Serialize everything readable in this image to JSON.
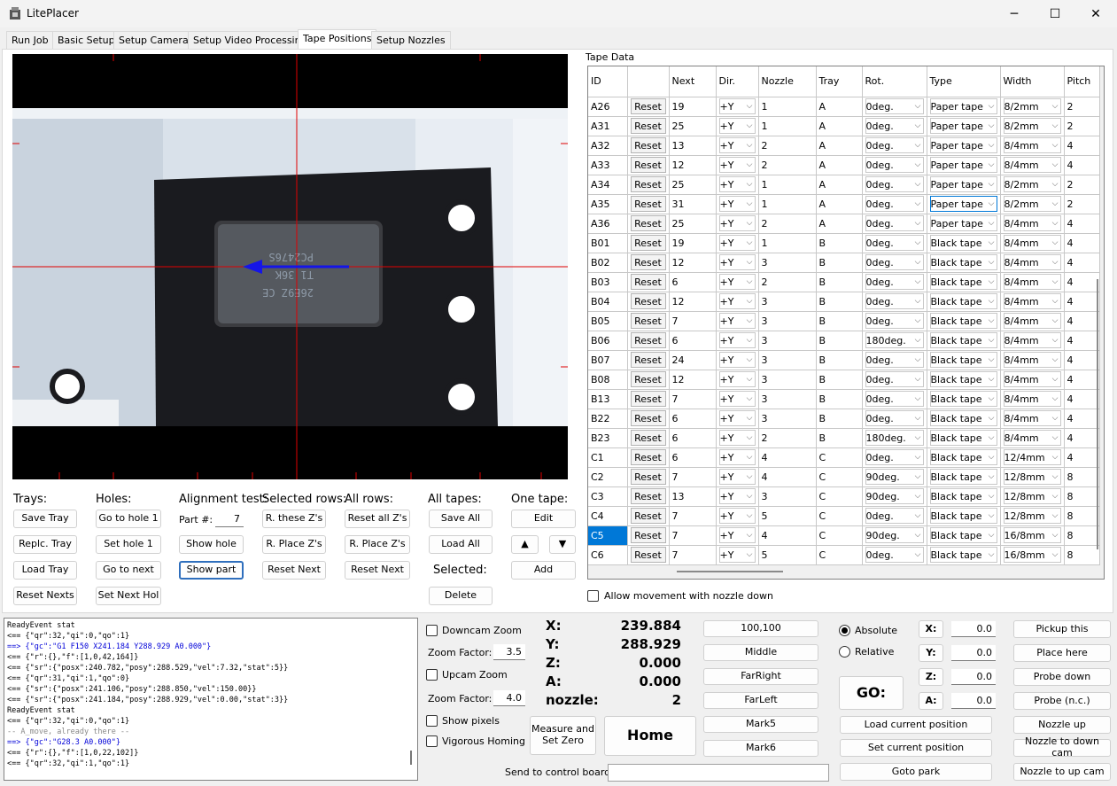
{
  "window": {
    "title": "LitePlacer",
    "minimize": "─",
    "maximize": "☐",
    "close": "✕"
  },
  "tabs": [
    "Run Job",
    "Basic Setup",
    "Setup Cameras",
    "Setup Video Processing",
    "Tape Positions",
    "Setup Nozzles"
  ],
  "tape_data_label": "Tape Data",
  "columns": [
    "ID",
    "",
    "Next",
    "Dir.",
    "Nozzle",
    "Tray",
    "Rot.",
    "Type",
    "Width",
    "Pitch"
  ],
  "reset_label": "Reset",
  "rows": [
    [
      "A26",
      "19",
      "+Y",
      "1",
      "A",
      "0deg.",
      "Paper tape",
      "8/2mm",
      "2"
    ],
    [
      "A31",
      "25",
      "+Y",
      "1",
      "A",
      "0deg.",
      "Paper tape",
      "8/2mm",
      "2"
    ],
    [
      "A32",
      "13",
      "+Y",
      "2",
      "A",
      "0deg.",
      "Paper tape",
      "8/4mm",
      "4"
    ],
    [
      "A33",
      "12",
      "+Y",
      "2",
      "A",
      "0deg.",
      "Paper tape",
      "8/4mm",
      "4"
    ],
    [
      "A34",
      "25",
      "+Y",
      "1",
      "A",
      "0deg.",
      "Paper tape",
      "8/2mm",
      "2"
    ],
    [
      "A35",
      "31",
      "+Y",
      "1",
      "A",
      "0deg.",
      "Paper tape",
      "8/2mm",
      "2"
    ],
    [
      "A36",
      "25",
      "+Y",
      "2",
      "A",
      "0deg.",
      "Paper tape",
      "8/4mm",
      "4"
    ],
    [
      "B01",
      "19",
      "+Y",
      "1",
      "B",
      "0deg.",
      "Black tape",
      "8/4mm",
      "4"
    ],
    [
      "B02",
      "12",
      "+Y",
      "3",
      "B",
      "0deg.",
      "Black tape",
      "8/4mm",
      "4"
    ],
    [
      "B03",
      "6",
      "+Y",
      "2",
      "B",
      "0deg.",
      "Black tape",
      "8/4mm",
      "4"
    ],
    [
      "B04",
      "12",
      "+Y",
      "3",
      "B",
      "0deg.",
      "Black tape",
      "8/4mm",
      "4"
    ],
    [
      "B05",
      "7",
      "+Y",
      "3",
      "B",
      "0deg.",
      "Black tape",
      "8/4mm",
      "4"
    ],
    [
      "B06",
      "6",
      "+Y",
      "3",
      "B",
      "180deg.",
      "Black tape",
      "8/4mm",
      "4"
    ],
    [
      "B07",
      "24",
      "+Y",
      "3",
      "B",
      "0deg.",
      "Black tape",
      "8/4mm",
      "4"
    ],
    [
      "B08",
      "12",
      "+Y",
      "3",
      "B",
      "0deg.",
      "Black tape",
      "8/4mm",
      "4"
    ],
    [
      "B13",
      "7",
      "+Y",
      "3",
      "B",
      "0deg.",
      "Black tape",
      "8/4mm",
      "4"
    ],
    [
      "B22",
      "6",
      "+Y",
      "3",
      "B",
      "0deg.",
      "Black tape",
      "8/4mm",
      "4"
    ],
    [
      "B23",
      "6",
      "+Y",
      "2",
      "B",
      "180deg.",
      "Black tape",
      "8/4mm",
      "4"
    ],
    [
      "C1",
      "6",
      "+Y",
      "4",
      "C",
      "0deg.",
      "Black tape",
      "12/4mm",
      "4"
    ],
    [
      "C2",
      "7",
      "+Y",
      "4",
      "C",
      "90deg.",
      "Black tape",
      "12/8mm",
      "8"
    ],
    [
      "C3",
      "13",
      "+Y",
      "3",
      "C",
      "90deg.",
      "Black tape",
      "12/8mm",
      "8"
    ],
    [
      "C4",
      "7",
      "+Y",
      "5",
      "C",
      "0deg.",
      "Black tape",
      "12/8mm",
      "8"
    ],
    [
      "C5",
      "7",
      "+Y",
      "4",
      "C",
      "90deg.",
      "Black tape",
      "16/8mm",
      "8"
    ],
    [
      "C6",
      "7",
      "+Y",
      "5",
      "C",
      "0deg.",
      "Black tape",
      "16/8mm",
      "8"
    ]
  ],
  "selected_id": "C5",
  "camera": {
    "chip_text": [
      "26E9Z CE",
      "T1 36K",
      "PC2476S"
    ]
  },
  "groups": {
    "trays": {
      "title": "Trays:",
      "buttons": [
        "Save Tray",
        "Replc. Tray",
        "Load Tray",
        "Reset Nexts"
      ]
    },
    "holes": {
      "title": "Holes:",
      "buttons": [
        "Go to hole 1",
        "Set hole 1",
        "Go to next",
        "Set Next Hol"
      ]
    },
    "alignment": {
      "title": "Alignment test:",
      "part_label": "Part #:",
      "part_value": "7",
      "buttons": [
        "Show hole",
        "Show part"
      ]
    },
    "selected_rows": {
      "title": "Selected rows:",
      "buttons": [
        "R. these Z's",
        "R. Place Z's",
        "Reset Next"
      ]
    },
    "all_rows": {
      "title": "All rows:",
      "buttons": [
        "Reset all Z's",
        "R. Place Z's",
        "Reset Next"
      ]
    },
    "all_tapes": {
      "title": "All tapes:",
      "buttons": [
        "Save All",
        "Load All"
      ],
      "selected_label": "Selected:",
      "delete": "Delete"
    },
    "one_tape": {
      "title": "One tape:",
      "edit": "Edit",
      "up": "▲",
      "down": "▼",
      "add": "Add"
    }
  },
  "allow_movement": "Allow movement with nozzle down",
  "log": [
    {
      "t": "ReadyEvent stat",
      "c": ""
    },
    {
      "t": "<== {\"qr\":32,\"qi\":0,\"qo\":1}",
      "c": ""
    },
    {
      "t": "==> {\"gc\":\"G1 F150 X241.184 Y288.929 A0.000\"}",
      "c": "blue"
    },
    {
      "t": "<== {\"r\":{},\"f\":[1,0,42,164]}",
      "c": ""
    },
    {
      "t": "<== {\"sr\":{\"posx\":240.782,\"posy\":288.529,\"vel\":7.32,\"stat\":5}}",
      "c": ""
    },
    {
      "t": "<== {\"qr\":31,\"qi\":1,\"qo\":0}",
      "c": ""
    },
    {
      "t": "<== {\"sr\":{\"posx\":241.106,\"posy\":288.850,\"vel\":150.00}}",
      "c": ""
    },
    {
      "t": "<== {\"sr\":{\"posx\":241.184,\"posy\":288.929,\"vel\":0.00,\"stat\":3}}",
      "c": ""
    },
    {
      "t": "ReadyEvent stat",
      "c": ""
    },
    {
      "t": "<== {\"qr\":32,\"qi\":0,\"qo\":1}",
      "c": ""
    },
    {
      "t": " -- A_move, already there --",
      "c": "gray"
    },
    {
      "t": "==> {\"gc\":\"G28.3 A0.000\"}",
      "c": "blue"
    },
    {
      "t": "<== {\"r\":{},\"f\":[1,0,22,102]}",
      "c": ""
    },
    {
      "t": "<== {\"qr\":32,\"qi\":1,\"qo\":1}",
      "c": ""
    }
  ],
  "zoom": {
    "downcam": "Downcam Zoom",
    "upcam": "Upcam Zoom",
    "factor_label": "Zoom Factor:",
    "down_factor": "3.5",
    "up_factor": "4.0",
    "show_pixels": "Show pixels",
    "vigorous": "Vigorous Homing"
  },
  "measure": "Measure and Set Zero",
  "home": "Home",
  "position": {
    "x_label": "X:",
    "x": "239.884",
    "y_label": "Y:",
    "y": "288.929",
    "z_label": "Z:",
    "z": "0.000",
    "a_label": "A:",
    "a": "0.000",
    "nozzle_label": "nozzle:",
    "nozzle": "2"
  },
  "goto_buttons": [
    "100,100",
    "Middle",
    "FarRight",
    "FarLeft",
    "Mark5",
    "Mark6"
  ],
  "mode": {
    "absolute": "Absolute",
    "relative": "Relative"
  },
  "go": "GO:",
  "axis_inputs": [
    {
      "label": "X:",
      "value": "0.0"
    },
    {
      "label": "Y:",
      "value": "0.0"
    },
    {
      "label": "Z:",
      "value": "0.0"
    },
    {
      "label": "A:",
      "value": "0.0"
    }
  ],
  "pos_buttons": [
    "Load current position",
    "Set current position",
    "Goto park"
  ],
  "right_buttons": [
    "Pickup this",
    "Place here",
    "Probe down",
    "Probe (n.c.)",
    "Nozzle up",
    "Nozzle to down cam",
    "Nozzle to up cam"
  ],
  "send_label": "Send to control board:"
}
